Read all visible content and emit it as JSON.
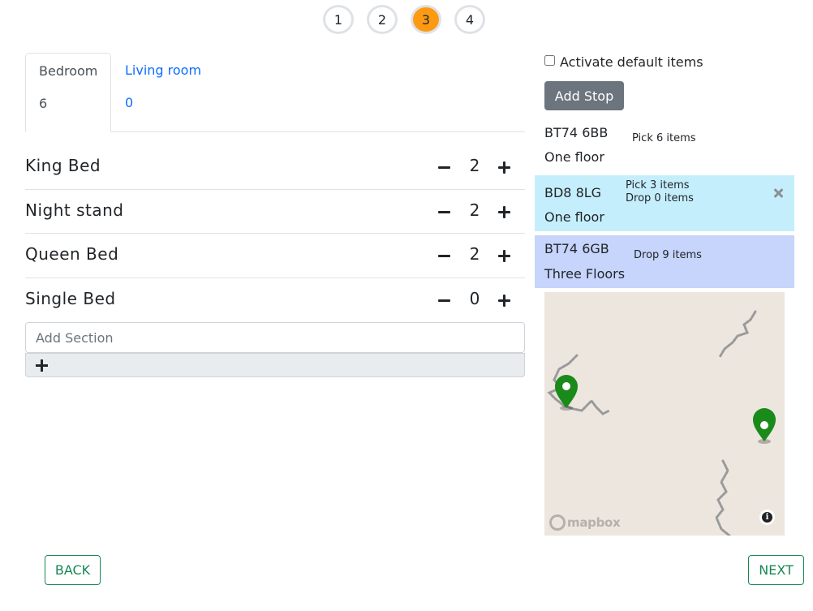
{
  "steps": [
    "1",
    "2",
    "3",
    "4"
  ],
  "active_step": "3",
  "tabs": [
    {
      "name": "Bedroom",
      "count": "6"
    },
    {
      "name": "Living room",
      "count": "0"
    }
  ],
  "items": [
    {
      "name": "King Bed",
      "count": "2"
    },
    {
      "name": "Night stand",
      "count": "2"
    },
    {
      "name": "Queen Bed",
      "count": "2"
    },
    {
      "name": "Single Bed",
      "count": "0"
    }
  ],
  "section": {
    "placeholder": "Add Section"
  },
  "default_items_label": "Activate default items",
  "add_stop_label": "Add Stop",
  "stops": [
    {
      "code": "BT74 6BB",
      "floor": "One floor",
      "action_1": "Pick 6 items",
      "action_2": ""
    },
    {
      "code": "BD8 8LG",
      "floor": "One floor",
      "action_1": "Pick 3 items",
      "action_2": "Drop 0 items"
    },
    {
      "code": "BT74 6GB",
      "floor": "Three Floors",
      "action_1": "Drop 9 items",
      "action_2": ""
    }
  ],
  "map": {
    "logo_text": "mapbox",
    "info_glyph": "i"
  },
  "nav": {
    "back": "BACK",
    "next": "NEXT"
  },
  "colors": {
    "active_step": "#fd9a12",
    "stop_selected": "#c5eefd",
    "stop_highlight": "#c7d4fb",
    "marker": "#1a8a1a",
    "nav": "#198754"
  }
}
